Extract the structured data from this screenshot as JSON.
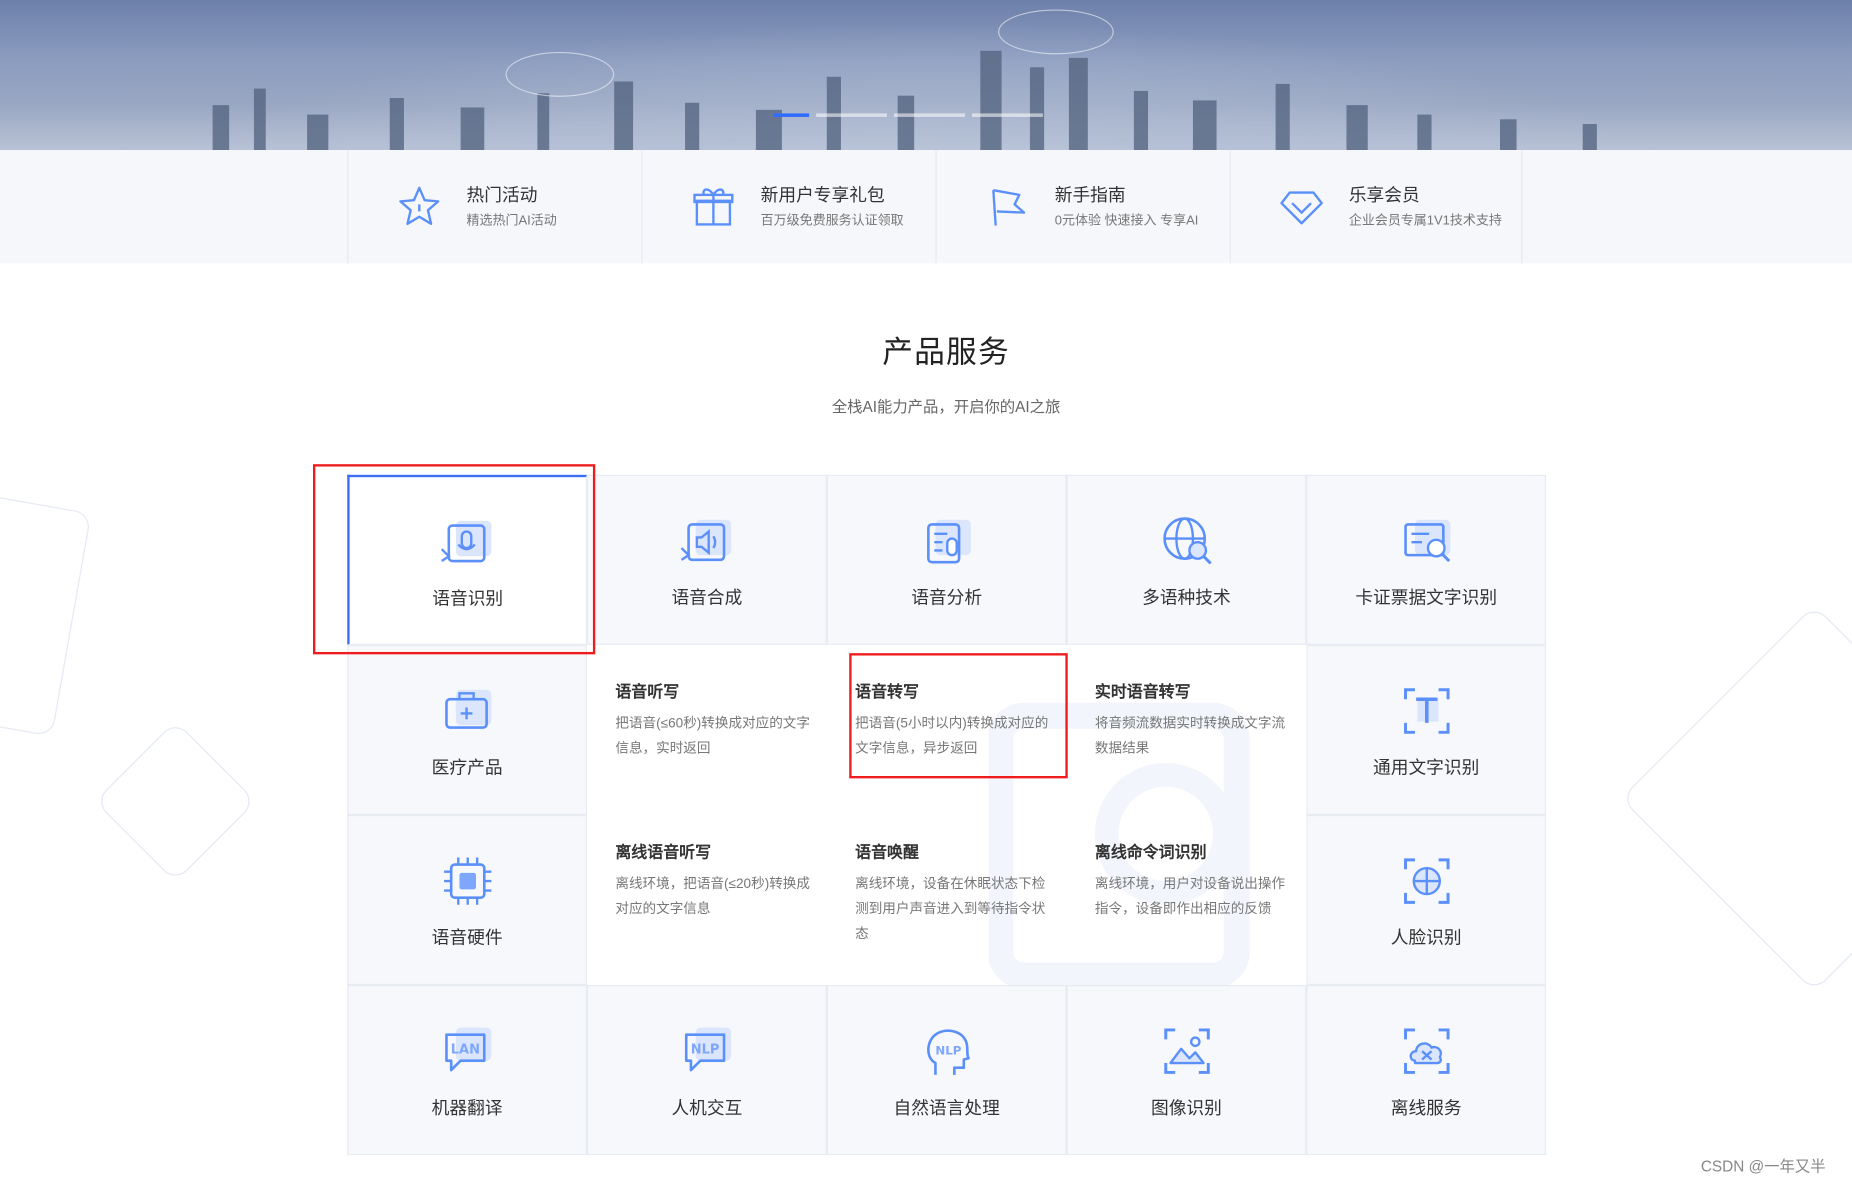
{
  "quick_links": [
    {
      "title": "热门活动",
      "subtitle": "精选热门AI活动",
      "icon": "star-icon"
    },
    {
      "title": "新用户专享礼包",
      "subtitle": "百万级免费服务认证领取",
      "icon": "gift-icon"
    },
    {
      "title": "新手指南",
      "subtitle": "0元体验 快速接入 专享AI",
      "icon": "flag-icon"
    },
    {
      "title": "乐享会员",
      "subtitle": "企业会员专属1V1技术支持",
      "icon": "diamond-icon"
    }
  ],
  "section": {
    "title": "产品服务",
    "subtitle": "全栈AI能力产品，开启你的AI之旅"
  },
  "categories": {
    "speech_recognition": {
      "label": "语音识别",
      "icon": "microphone-icon"
    },
    "speech_synthesis": {
      "label": "语音合成",
      "icon": "speaker-icon"
    },
    "speech_analysis": {
      "label": "语音分析",
      "icon": "speech-analysis-icon"
    },
    "multilingual": {
      "label": "多语种技术",
      "icon": "globe-search-icon"
    },
    "card_ocr": {
      "label": "卡证票据文字识别",
      "icon": "document-search-icon"
    },
    "medical": {
      "label": "医疗产品",
      "icon": "medical-kit-icon"
    },
    "general_ocr": {
      "label": "通用文字识别",
      "icon": "text-scan-icon"
    },
    "speech_hardware": {
      "label": "语音硬件",
      "icon": "chip-icon"
    },
    "face_recognition": {
      "label": "人脸识别",
      "icon": "face-scan-icon"
    },
    "machine_translation": {
      "label": "机器翻译",
      "icon": "lan-chat-icon"
    },
    "human_computer_interaction": {
      "label": "人机交互",
      "icon": "nlp-chat-icon"
    },
    "nlp": {
      "label": "自然语言处理",
      "icon": "nlp-head-icon"
    },
    "image_recognition": {
      "label": "图像识别",
      "icon": "image-scan-icon"
    },
    "offline_services": {
      "label": "离线服务",
      "icon": "cloud-offline-icon"
    }
  },
  "speech_recognition_products": {
    "dictation": {
      "title": "语音听写",
      "desc": "把语音(≤60秒)转换成对应的文字信息，实时返回"
    },
    "transcription": {
      "title": "语音转写",
      "desc": "把语音(5小时以内)转换成对应的文字信息，异步返回"
    },
    "realtime_transcription": {
      "title": "实时语音转写",
      "desc": "将音频流数据实时转换成文字流数据结果"
    },
    "offline_dictation": {
      "title": "离线语音听写",
      "desc": "离线环境，把语音(≤20秒)转换成对应的文字信息"
    },
    "wakeup": {
      "title": "语音唤醒",
      "desc": "离线环境，设备在休眠状态下检测到用户声音进入到等待指令状态"
    },
    "offline_command": {
      "title": "离线命令词识别",
      "desc": "离线环境，用户对设备说出操作指令，设备即作出相应的反馈"
    }
  },
  "watermark": "CSDN @一年又半",
  "colors": {
    "accent": "#3c6ef5",
    "icon_blue": "#5b8ff9",
    "annotation_red": "#ee1c1c"
  }
}
